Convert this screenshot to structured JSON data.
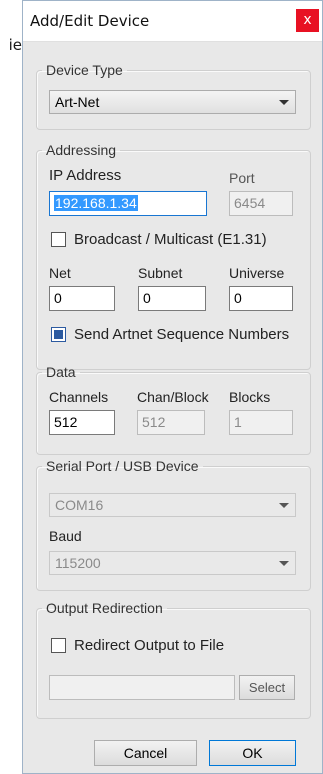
{
  "background": {
    "fragment": "ie"
  },
  "window": {
    "title": "Add/Edit Device",
    "close_glyph": "x"
  },
  "device_type": {
    "legend": "Device Type",
    "value": "Art-Net"
  },
  "addressing": {
    "legend": "Addressing",
    "ip_label": "IP Address",
    "ip_value": "192.168.1.34",
    "port_label": "Port",
    "port_value": "6454",
    "broadcast_label": "Broadcast / Multicast (E1.31)",
    "broadcast_checked": false,
    "net_label": "Net",
    "net_value": "0",
    "subnet_label": "Subnet",
    "subnet_value": "0",
    "universe_label": "Universe",
    "universe_value": "0",
    "sequence_label": "Send Artnet Sequence Numbers",
    "sequence_checked": true
  },
  "data": {
    "legend": "Data",
    "channels_label": "Channels",
    "channels_value": "512",
    "chan_block_label": "Chan/Block",
    "chan_block_value": "512",
    "blocks_label": "Blocks",
    "blocks_value": "1"
  },
  "serial": {
    "legend": "Serial Port / USB Device",
    "port_value": "COM16",
    "baud_label": "Baud",
    "baud_value": "115200"
  },
  "output": {
    "legend": "Output Redirection",
    "redirect_label": "Redirect Output to File",
    "redirect_checked": false,
    "file_value": "",
    "select_label": "Select"
  },
  "buttons": {
    "cancel": "Cancel",
    "ok": "OK"
  },
  "colors": {
    "close_button": "#e81123",
    "selection": "#3399ff",
    "checked_box": "#2c5aa0"
  }
}
